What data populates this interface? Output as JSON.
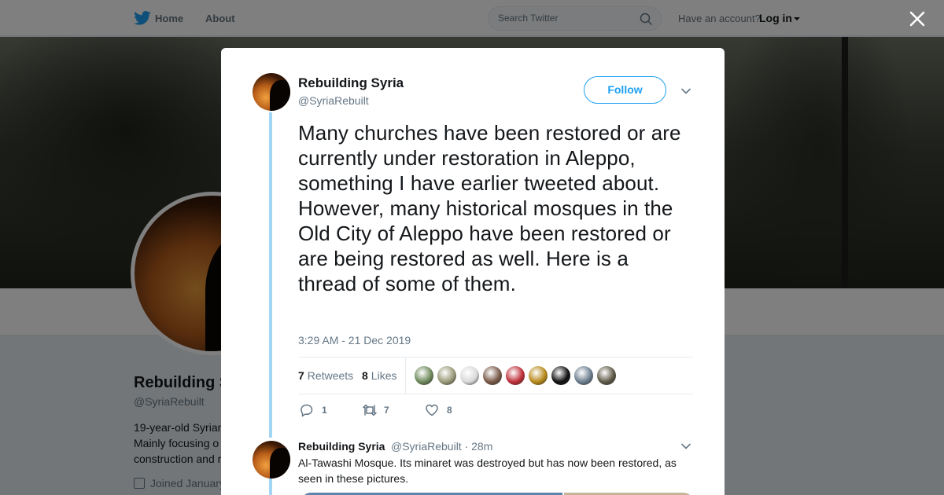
{
  "nav": {
    "home": "Home",
    "about": "About",
    "search_placeholder": "Search Twitter",
    "account_prompt": "Have an account?",
    "login": "Log in"
  },
  "profile": {
    "name": "Rebuilding Syria",
    "handle": "@SyriaRebuilt",
    "bio_lines": [
      "19-year-old Syrian",
      "Mainly focusing o",
      "construction and r"
    ],
    "joined": "Joined January"
  },
  "tweet": {
    "name": "Rebuilding Syria",
    "handle": "@SyriaRebuilt",
    "follow_label": "Follow",
    "text": "Many churches have been restored or are currently under restoration in Aleppo, something I have earlier tweeted about. However, many historical mosques in the Old City of Aleppo have been restored or are being restored as well. Here is a thread of some of them.",
    "timestamp": "3:29 AM - 21 Dec 2019",
    "retweets_count": "7",
    "retweets_label": "Retweets",
    "likes_count": "8",
    "likes_label": "Likes",
    "likers": [
      {
        "icon": "liker-avatar",
        "color": "#6f8a5c"
      },
      {
        "icon": "liker-avatar",
        "color": "#9a9a7a"
      },
      {
        "icon": "liker-avatar",
        "color": "#d9d9d9"
      },
      {
        "icon": "liker-avatar",
        "color": "#7a5a48"
      },
      {
        "icon": "liker-avatar",
        "color": "#c0303a"
      },
      {
        "icon": "liker-avatar",
        "color": "#b88a1c"
      },
      {
        "icon": "liker-avatar",
        "color": "#111111"
      },
      {
        "icon": "liker-avatar",
        "color": "#6d7f90"
      },
      {
        "icon": "liker-avatar",
        "color": "#5f5a48"
      }
    ],
    "replies": "1",
    "retweets": "7",
    "likes": "8"
  },
  "reply": {
    "name": "Rebuilding Syria",
    "meta": "@SyriaRebuilt · 28m",
    "text": "Al-Tawashi Mosque. Its minaret was destroyed but has now been restored, as seen in these pictures."
  },
  "colors": {
    "accent": "#1da1f2",
    "thread_line": "#a3d6f5",
    "muted_text": "#657786"
  }
}
